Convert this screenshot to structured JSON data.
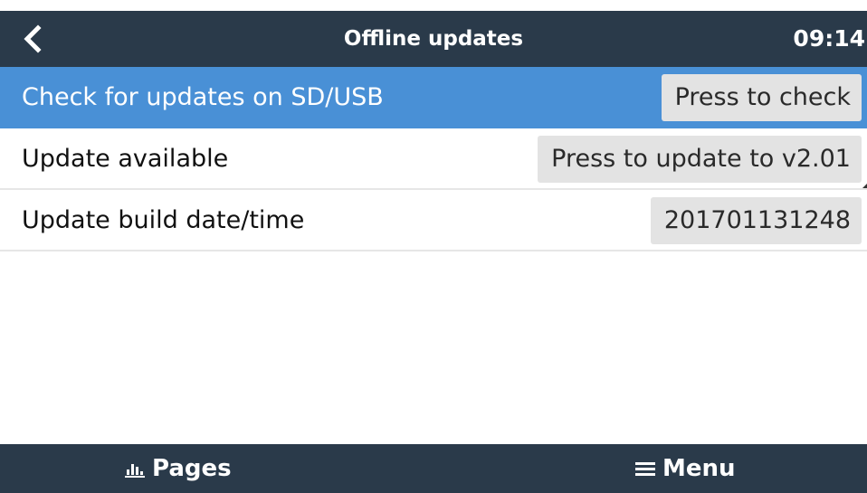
{
  "header": {
    "back_icon": "chevron-left-icon",
    "title": "Offline updates",
    "time": "09:14"
  },
  "rows": [
    {
      "label": "Check for updates on SD/USB",
      "value": "Press to check",
      "selected": true
    },
    {
      "label": "Update available",
      "value": "Press to update to v2.01",
      "selected": false
    },
    {
      "label": "Update build date/time",
      "value": "201701131248",
      "selected": false
    }
  ],
  "footer": {
    "pages_label": "Pages",
    "pages_icon": "bar-chart-icon",
    "menu_label": "Menu",
    "menu_icon": "hamburger-menu-icon"
  },
  "colors": {
    "header_bg": "#2a3a4a",
    "selected_row_bg": "#4990d6",
    "value_box_bg": "#e3e3e3"
  }
}
